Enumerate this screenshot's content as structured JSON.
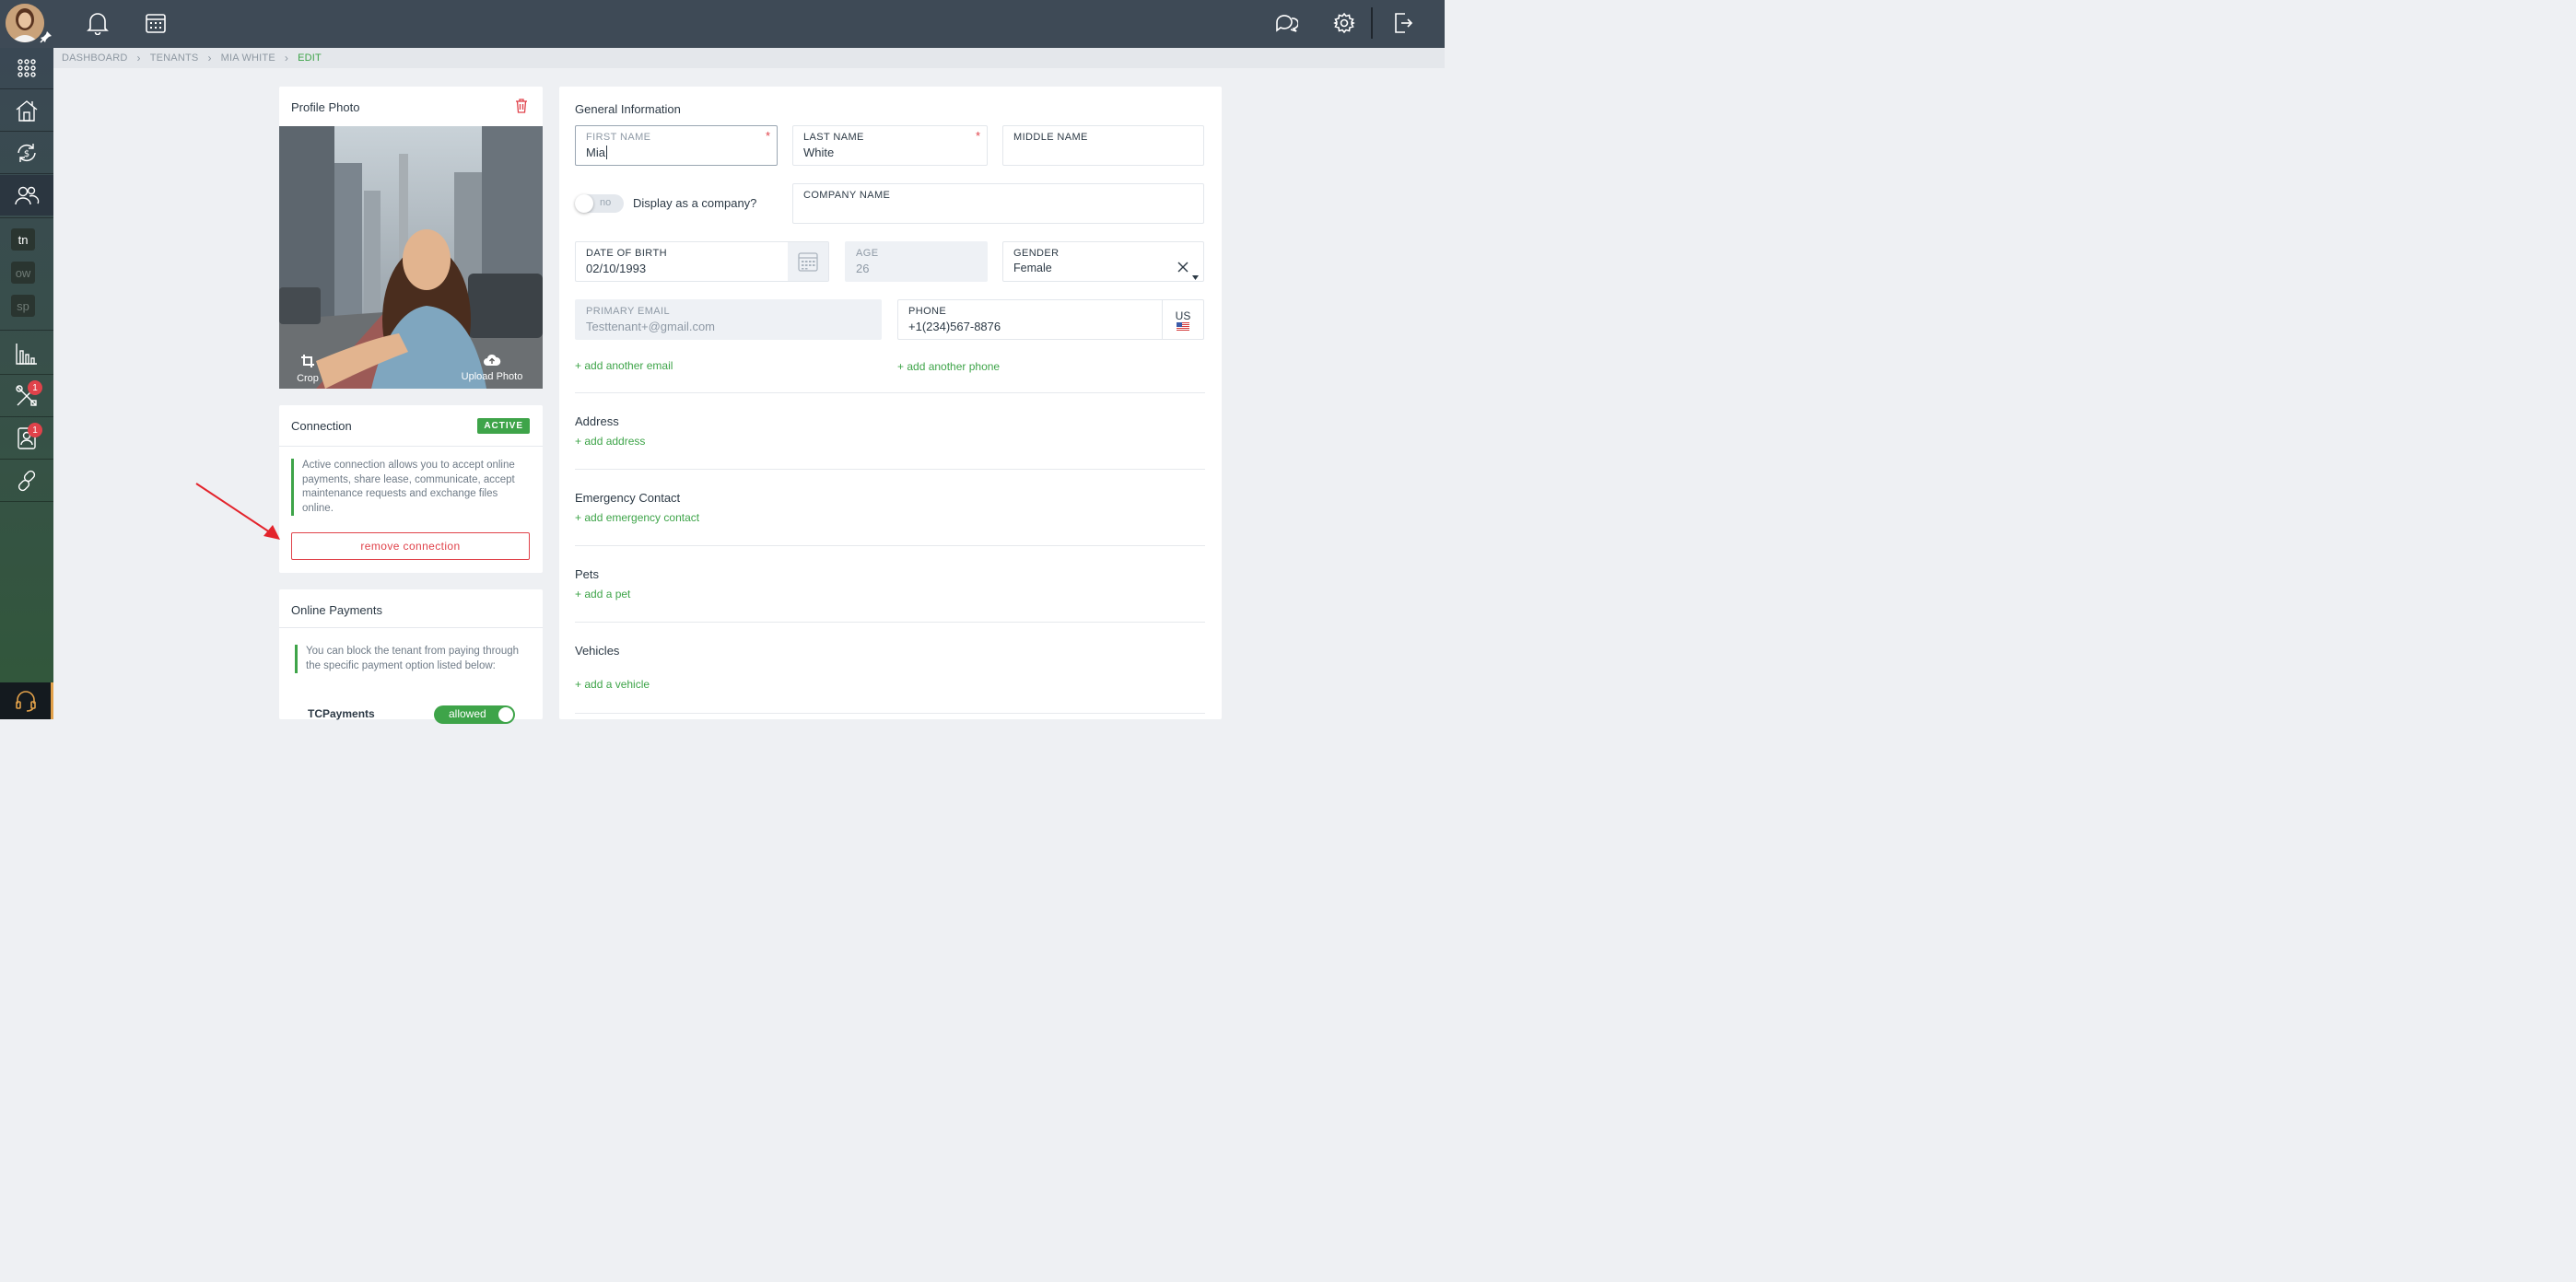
{
  "colors": {
    "accent_green": "#3ea449",
    "danger_red": "#e0424a",
    "topbar": "#3e4a56"
  },
  "breadcrumb": [
    "DASHBOARD",
    "TENANTS",
    "MIA WHITE",
    "EDIT"
  ],
  "sidebar": {
    "letters": [
      "tn",
      "ow",
      "sp"
    ],
    "badges": {
      "maintenance": "1",
      "tenant_portal": "1"
    }
  },
  "profile_photo": {
    "title": "Profile Photo",
    "crop_label": "Crop",
    "upload_label": "Upload Photo"
  },
  "connection": {
    "title": "Connection",
    "status": "ACTIVE",
    "description": "Active connection allows you to accept online payments, share lease, communicate, accept maintenance requests and exchange files online.",
    "remove_label": "remove connection"
  },
  "online_payments": {
    "title": "Online Payments",
    "description": "You can block the tenant from paying through the specific payment option listed below:",
    "option_label": "TCPayments",
    "option_toggle": "allowed"
  },
  "general": {
    "title": "General Information",
    "first_name": {
      "label": "FIRST NAME",
      "value": "Mia"
    },
    "last_name": {
      "label": "LAST NAME",
      "value": "White"
    },
    "middle_name": {
      "label": "MIDDLE NAME",
      "value": ""
    },
    "company_toggle": {
      "state": "no",
      "label": "Display as a company?"
    },
    "company_name": {
      "label": "COMPANY NAME",
      "value": ""
    },
    "dob": {
      "label": "DATE OF BIRTH",
      "value": "02/10/1993"
    },
    "age": {
      "label": "AGE",
      "value": "26"
    },
    "gender": {
      "label": "GENDER",
      "value": "Female"
    },
    "email": {
      "label": "PRIMARY EMAIL",
      "value": "Testtenant+@gmail.com"
    },
    "phone": {
      "label": "PHONE",
      "value": "+1(234)567-8876",
      "country": "US"
    },
    "add_email": "+ add another email",
    "add_phone": "+ add another phone"
  },
  "sections": {
    "address": {
      "title": "Address",
      "link": "+ add address"
    },
    "emergency": {
      "title": "Emergency Contact",
      "link": "+ add emergency contact"
    },
    "pets": {
      "title": "Pets",
      "link": "+ add a pet"
    },
    "vehicles": {
      "title": "Vehicles",
      "link": "+ add a vehicle"
    }
  }
}
